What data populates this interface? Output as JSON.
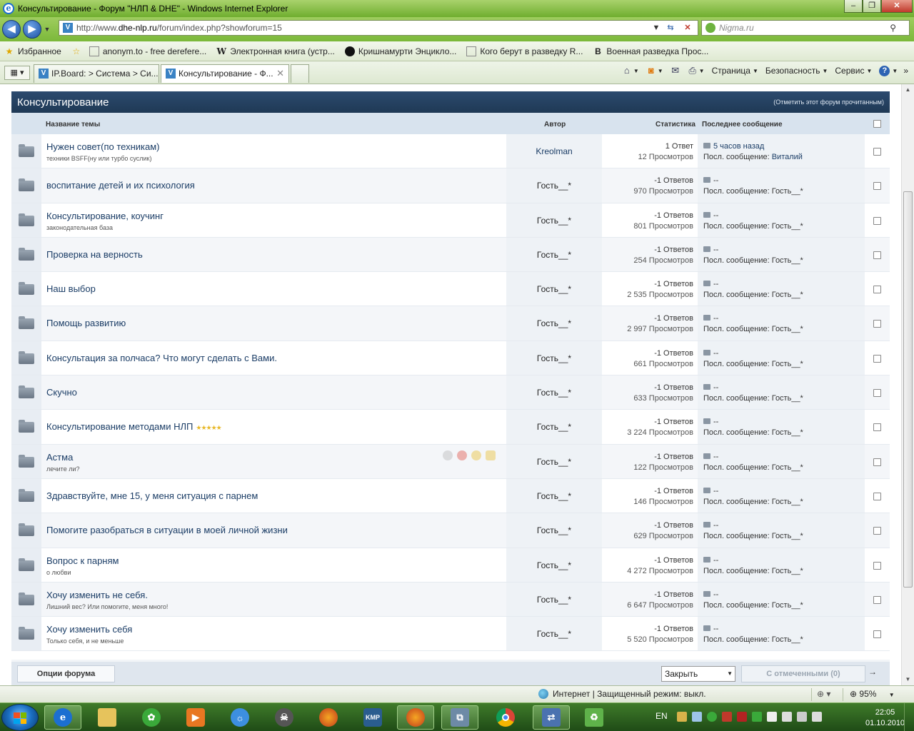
{
  "window": {
    "title": "Консультирование - Форум \"НЛП & DHE\" - Windows Internet Explorer",
    "minimize": "–",
    "maximize": "❐",
    "close": "✕"
  },
  "address_bar": {
    "url_prefix": "http://www.",
    "url_domain": "dhe-nlp.ru",
    "url_path": "/forum/index.php?showforum=15",
    "search_placeholder": "Nigma.ru"
  },
  "favorites": {
    "label": "Избранное",
    "items": [
      "anonym.to - free derefere...",
      "Электронная книга (устр...",
      "Кришнамурти  Энцикло...",
      "Кого берут в разведку  R...",
      "Военная разведка  Прос..."
    ]
  },
  "tabs": [
    {
      "label": "IP.Board: > Система > Си..."
    },
    {
      "label": "Консультирование - Ф...",
      "active": true
    }
  ],
  "command_bar": {
    "page": "Страница",
    "safety": "Безопасность",
    "tools": "Сервис"
  },
  "forum": {
    "title": "Консультирование",
    "mark_read": "(Отметить этот форум прочитанным)",
    "columns": {
      "title": "Название темы",
      "author": "Автор",
      "stats": "Статистика",
      "last": "Последнее сообщение"
    },
    "topics": [
      {
        "title": "Нужен совет(по техникам)",
        "desc": "техники BSFF(ну или турбо суслик)",
        "author": "Kreolman",
        "replies": "1 Ответ",
        "views": "12 Просмотров",
        "last_time": "5 часов назад",
        "last_by_label": "Посл. сообщение:",
        "last_by": "Виталий"
      },
      {
        "title": "воспитание детей и их психология",
        "desc": "",
        "author": "Гость__*",
        "replies": "-1 Ответов",
        "views": "970 Просмотров",
        "last_time": "--",
        "last_by_label": "Посл. сообщение:",
        "last_by": "Гость__*"
      },
      {
        "title": "Консультирование, коучинг",
        "desc": "законодательная база",
        "author": "Гость__*",
        "replies": "-1 Ответов",
        "views": "801 Просмотров",
        "last_time": "--",
        "last_by_label": "Посл. сообщение:",
        "last_by": "Гость__*"
      },
      {
        "title": "Проверка на верность",
        "desc": "",
        "author": "Гость__*",
        "replies": "-1 Ответов",
        "views": "254 Просмотров",
        "last_time": "--",
        "last_by_label": "Посл. сообщение:",
        "last_by": "Гость__*"
      },
      {
        "title": "Наш выбор",
        "desc": "",
        "author": "Гость__*",
        "replies": "-1 Ответов",
        "views": "2 535 Просмотров",
        "last_time": "--",
        "last_by_label": "Посл. сообщение:",
        "last_by": "Гость__*"
      },
      {
        "title": "Помощь развитию",
        "desc": "",
        "author": "Гость__*",
        "replies": "-1 Ответов",
        "views": "2 997 Просмотров",
        "last_time": "--",
        "last_by_label": "Посл. сообщение:",
        "last_by": "Гость__*"
      },
      {
        "title": "Консультация за полчаса? Что могут сделать с Вами.",
        "desc": "",
        "author": "Гость__*",
        "replies": "-1 Ответов",
        "views": "661 Просмотров",
        "last_time": "--",
        "last_by_label": "Посл. сообщение:",
        "last_by": "Гость__*"
      },
      {
        "title": "Скучно",
        "desc": "",
        "author": "Гость__*",
        "replies": "-1 Ответов",
        "views": "633 Просмотров",
        "last_time": "--",
        "last_by_label": "Посл. сообщение:",
        "last_by": "Гость__*"
      },
      {
        "title": "Консультирование методами НЛП",
        "desc": "",
        "author": "Гость__*",
        "replies": "-1 Ответов",
        "views": "3 224 Просмотров",
        "last_time": "--",
        "last_by_label": "Посл. сообщение:",
        "last_by": "Гость__*",
        "stars": "★★★★★"
      },
      {
        "title": "Астма",
        "desc": "лечите ли?",
        "author": "Гость__*",
        "replies": "-1 Ответов",
        "views": "122 Просмотров",
        "last_time": "--",
        "last_by_label": "Посл. сообщение:",
        "last_by": "Гость__*"
      },
      {
        "title": "Здравствуйте, мне 15, у меня ситуация с парнем",
        "desc": "",
        "author": "Гость__*",
        "replies": "-1 Ответов",
        "views": "146 Просмотров",
        "last_time": "--",
        "last_by_label": "Посл. сообщение:",
        "last_by": "Гость__*"
      },
      {
        "title": "Помогите разобраться в ситуации в моей личной жизни",
        "desc": "",
        "author": "Гость__*",
        "replies": "-1 Ответов",
        "views": "629 Просмотров",
        "last_time": "--",
        "last_by_label": "Посл. сообщение:",
        "last_by": "Гость__*"
      },
      {
        "title": "Вопрос к парням",
        "desc": "о любви",
        "author": "Гость__*",
        "replies": "-1 Ответов",
        "views": "4 272 Просмотров",
        "last_time": "--",
        "last_by_label": "Посл. сообщение:",
        "last_by": "Гость__*"
      },
      {
        "title": "Хочу изменить не себя.",
        "desc": "Лишний вес? Или помогите, меня много!",
        "author": "Гость__*",
        "replies": "-1 Ответов",
        "views": "6 647 Просмотров",
        "last_time": "--",
        "last_by_label": "Посл. сообщение:",
        "last_by": "Гость__*"
      },
      {
        "title": "Хочу изменить себя",
        "desc": "Только себя, и не меньше",
        "author": "Гость__*",
        "replies": "-1 Ответов",
        "views": "5 520 Просмотров",
        "last_time": "--",
        "last_by_label": "Посл. сообщение:",
        "last_by": "Гость__*"
      }
    ],
    "footer": {
      "options": "Опции форума",
      "action_select": "Закрыть",
      "checked_button": "С отмеченными (0)",
      "go": "→"
    }
  },
  "status_bar": {
    "zone": "Интернет | Защищенный режим: выкл.",
    "zoom": "95%"
  },
  "taskbar": {
    "lang": "EN",
    "time": "22:05",
    "date": "01.10.2010"
  },
  "colors": {
    "forum_header": "#2c4a6e",
    "link": "#1b3d66",
    "taskbar": "#2f6322"
  }
}
